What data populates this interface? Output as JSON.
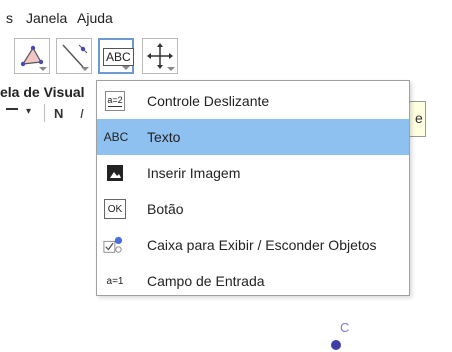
{
  "menubar": {
    "items": [
      "s",
      "Janela",
      "Ajuda"
    ]
  },
  "toolbar": {
    "tools": [
      {
        "name": "polygon-tool",
        "selected": false
      },
      {
        "name": "perpendicular-line-tool",
        "selected": false
      },
      {
        "name": "text-tool",
        "label": "ABC",
        "selected": true
      },
      {
        "name": "move-graphics-view-tool",
        "selected": false
      }
    ]
  },
  "panel": {
    "title": "ela de Visual",
    "format_bold": "N",
    "format_italic": "I"
  },
  "tooltip_text": "e",
  "dropdown": {
    "items": [
      {
        "icon": "a=2",
        "label": "Controle Deslizante",
        "selected": false
      },
      {
        "icon": "ABC",
        "label": "Texto",
        "selected": true
      },
      {
        "icon": "image",
        "label": "Inserir Imagem",
        "selected": false
      },
      {
        "icon": "OK",
        "label": "Botão",
        "selected": false
      },
      {
        "icon": "checkbox",
        "label": "Caixa para Exibir / Esconder Objetos",
        "selected": false
      },
      {
        "icon": "a=1",
        "label": "Campo de Entrada",
        "selected": false
      }
    ]
  },
  "graphics": {
    "point_label": "C",
    "point_color": "#3f3fa8",
    "label_color": "#7a7ae0"
  },
  "colors": {
    "selection": "#8ec1f0",
    "selected_tool_border": "#6b9bd2"
  }
}
